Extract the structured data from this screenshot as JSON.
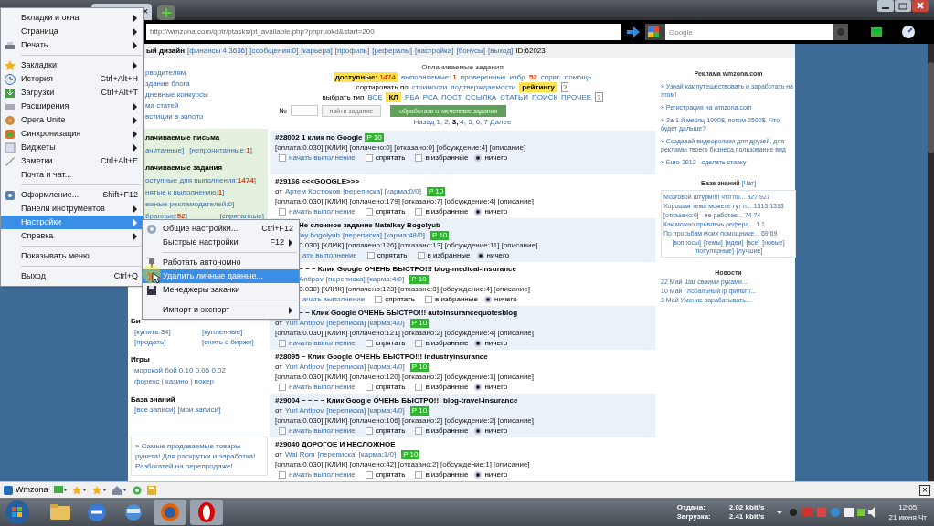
{
  "browser": {
    "tab_close": "×",
    "url": "http://wmzona.com/qptr/ptasks/pt_available.php?phpruokd&start=200",
    "search_placeholder": "Google"
  },
  "topstrip": {
    "lead": "ый дизайн",
    "links": [
      "[финансы 4.3636]",
      "[сообщения:0]",
      "[карьера]",
      "[профиль]",
      "[рефералы]",
      "[настройка]",
      "[бонусы]",
      "[выход]"
    ],
    "id": "ID:62023"
  },
  "left": {
    "top_links": [
      "рводителям",
      "здание блога",
      "дневные конкурсы",
      "ма статей",
      "встиции в золото"
    ],
    "mail_heading": "лачиваемые письма",
    "mail_links": [
      {
        "text": "ачитанные]"
      },
      {
        "text": "[непрочитанные:",
        "count": "1",
        "tail": "]"
      }
    ],
    "tasks_heading": "лачиваемые задания",
    "task_links": [
      {
        "text": "оступные для выполнения:",
        "count": "1474",
        "tail": "]"
      },
      {
        "text": "нятые к выполнению:",
        "count": "1",
        "tail": "]"
      },
      {
        "text": "ежные рекламодателей:0]"
      },
      {
        "text": "бранные:",
        "count": "52",
        "tail": "]"
      },
      {
        "text": "[спрятанные]"
      }
    ],
    "exchange_heading": "Би",
    "exchange_links": [
      "[купить:34]",
      "[купленные]",
      "[продать]",
      "[снять с биржи]"
    ],
    "games_heading": "Игры",
    "games_lines": [
      "морской бой 0.10 0.05 0.02",
      "форекс | казино | покер"
    ],
    "kb_heading": "База знаний",
    "kb_links": [
      "[все записи]",
      "[мои записи]"
    ],
    "promo": "» Самые продаваемые товары рунета! Для раскрутки и заработка! Разбогатей на перепродаже!"
  },
  "tasks_header": {
    "title": "Оплачиваемые задания",
    "filters": [
      {
        "label": "доступные:",
        "count": "1474",
        "selected": true
      },
      {
        "label": "выполняемые:",
        "count": "1",
        "selected": false
      },
      {
        "label": "проверенные",
        "selected": false
      },
      {
        "label": "избр.",
        "count": "52",
        "selected": false
      },
      {
        "label": "спрят.",
        "selected": false
      },
      {
        "label": "помощь",
        "selected": false
      }
    ],
    "sort_label": "сортировать по",
    "sorts": [
      {
        "label": "стоимости",
        "selected": false
      },
      {
        "label": "подтверждаемости",
        "selected": false
      },
      {
        "label": "рейтингу",
        "selected": true
      }
    ],
    "type_label": "выбрать тип",
    "types": [
      {
        "label": "ВСЕ",
        "selected": false
      },
      {
        "label": "КЛ",
        "selected": true
      },
      {
        "label": "РБА",
        "selected": false
      },
      {
        "label": "РСА",
        "selected": false
      },
      {
        "label": "ПОСТ",
        "selected": false
      },
      {
        "label": "ССЫЛКА",
        "selected": false
      },
      {
        "label": "СТАТЬИ",
        "selected": false
      },
      {
        "label": "ПОИСК",
        "selected": false
      },
      {
        "label": "ПРОЧЕЕ",
        "selected": false
      }
    ],
    "help": "?",
    "number_label": "№",
    "find_button": "найти задание",
    "process_button": "обработать отмеченные задания",
    "pages": [
      {
        "label": "Назад",
        "selected": false
      },
      {
        "label": "1,",
        "selected": false
      },
      {
        "label": "2,",
        "selected": false
      },
      {
        "label": "3,",
        "selected": true
      },
      {
        "label": "4,",
        "selected": false
      },
      {
        "label": "5,",
        "selected": false
      },
      {
        "label": "6,",
        "selected": false
      },
      {
        "label": "7",
        "selected": false
      },
      {
        "label": "Далее",
        "selected": false
      }
    ]
  },
  "tasks": [
    {
      "title": "#28002 1 клик по Google",
      "title_covered": false,
      "badge": "P 10",
      "info": "[оплата:0.030] [КЛИК] [оплачено:0] [отказано:0] [обсуждение:4] [описание]",
      "info_covered": false,
      "start": "начать выполнение",
      "hide": "спрятать",
      "fav": "в избранные",
      "none": "ничего",
      "none_selected": true,
      "actions_covered": false,
      "shaded": true
    },
    {
      "title": "#29166 <<<GOOGLE>>>",
      "title_covered": false,
      "from": "от",
      "author": "Артем Костюков",
      "meta": "[переписка] [карма:0/0]",
      "badge": "P 10",
      "info": "[оплата:0.030] [КЛИК] [оплачено:179] [отказано:7] [обсуждение:4] [описание]",
      "info_covered": false,
      "start": "начать выполнение",
      "hide": "спрятать",
      "fav": "в избранные",
      "none": "ничего",
      "none_selected": true,
      "actions_covered": false,
      "shaded": false
    },
    {
      "title": "Не сложное задание Natalkay Bogolyub",
      "title_covered": true,
      "author": "lay bogolyub",
      "meta": "[переписка] [карма:48/0]",
      "badge": "P 10",
      "info": "0.030] [КЛИК] [оплачено:126] [отказано:13] [обсуждение:11] [описание]",
      "info_covered": true,
      "start": "ать выполнение",
      "hide": "спрятать",
      "fav": "в избранные",
      "none": "ничего",
      "none_selected": true,
      "actions_covered": true,
      "shaded": true
    },
    {
      "title": "~ ~ ~ Клик Google ОЧЕНЬ БЫСТРО!!! blog-medical-insurance",
      "title_covered": true,
      "author": "Antipov",
      "meta": "[переписка] [карма:4/0]",
      "badge": "P 10",
      "info": "0.030] [КЛИК] [оплачено:123] [отказано:0] [обсуждение:4] [описание]",
      "info_covered": true,
      "start": "ачать выполнение",
      "hide": "спрятать",
      "fav": "в избранные",
      "none": "ничего",
      "none_selected": true,
      "actions_covered": true,
      "shaded": false
    },
    {
      "title": "~ ~ Клик Google ОЧЕНЬ БЫСТРО!!! autoinsurancequotesblog",
      "title_covered": true,
      "from": "от",
      "author": "Yuri Antipov",
      "meta": "[переписка] [карма:4/0]",
      "badge": "P 10",
      "info": "[оплата:0.030] [КЛИК] [оплачено:121] [отказано:2] [обсуждение:4] [описание]",
      "info_covered": false,
      "start": "начать выполнение",
      "hide": "спрятать",
      "fav": "в избранные",
      "none": "ничего",
      "none_selected": true,
      "actions_covered": false,
      "shaded": true
    },
    {
      "title": "#28095 ~ Клик Google ОЧЕНЬ БЫСТРО!!! industryinsurance",
      "title_covered": false,
      "from": "от",
      "author": "Yuri Antipov",
      "meta": "[переписка] [карма:4/0]",
      "badge": "P 10",
      "info": "[оплата:0.030] [КЛИК] [оплачено:120] [отказано:2] [обсуждение:1] [описание]",
      "info_covered": false,
      "start": "начать выполнение",
      "hide": "спрятать",
      "fav": "в избранные",
      "none": "ничего",
      "none_selected": true,
      "actions_covered": false,
      "shaded": false
    },
    {
      "title": "#29004 ~ ~ ~ ~ Клик Google ОЧЕНЬ БЫСТРО!!! blog-travel-insurance",
      "title_covered": false,
      "from": "от",
      "author": "Yuri Antipov",
      "meta": "[переписка] [карма:4/0]",
      "badge": "P 10",
      "info": "[оплата:0.030] [КЛИК] [оплачено:106] [отказано:2] [обсуждение:2] [описание]",
      "info_covered": false,
      "start": "начать выполнение",
      "hide": "спрятать",
      "fav": "в избранные",
      "none": "ничего",
      "none_selected": true,
      "actions_covered": false,
      "shaded": true
    },
    {
      "title": "#29040 ДОРОГОЕ И НЕСЛОЖНОЕ",
      "title_covered": false,
      "from": "от",
      "author": "Wal Rom",
      "meta": "[переписка] [карма:1/0]",
      "badge": "P 10",
      "info": "[оплата:0.030] [КЛИК] [оплачено:42] [отказано:2] [обсуждение:1] [описание]",
      "info_covered": false,
      "start": "начать выполнение",
      "hide": "спрятать",
      "fav": "в избранные",
      "none": "ничего",
      "none_selected": true,
      "actions_covered": false,
      "shaded": false
    }
  ],
  "right": {
    "ads_title": "Реклама wmzona.com",
    "ads": [
      "» Узнай как путешествовать и заработать на этом!",
      "» Регистрация на wmzona.com",
      "» За 1-й месяц-1000$, потом 2500$. Что будет дальше?",
      "» Создавай видеоролики для друзей, для рекламы твоего бизнеса.пользование вид",
      "» Euro-2012 - сделать ставку"
    ],
    "kb_title": "База знаний",
    "kb_chat": "[Чат]",
    "kb_items": [
      "Мозговой штурм!!!! что по... 927 927",
      "Хорошая тема можете тут п... 1313 1313",
      "[отказано:0] - не работае... 74 74",
      "Как можно привлечь рефера... 1 1",
      "По просьбам моих помощнике... 69 69"
    ],
    "kb_links": [
      "[вопросы]",
      "[темы]",
      "[идеи]",
      "[все]",
      "[новые]",
      "[популярные]",
      "[лучшие]"
    ],
    "news_title": "Новости",
    "news": [
      "22 Май Шаг своими руками...",
      "10 Май Глобальный ip фильтр...",
      "3 Май Умение зарабатывать..."
    ]
  },
  "menu": [
    {
      "kind": "item",
      "label": "Вкладки и окна",
      "submenu": true,
      "selected": false
    },
    {
      "kind": "item",
      "label": "Страница",
      "submenu": true,
      "selected": false
    },
    {
      "kind": "item",
      "label": "Печать",
      "submenu": true,
      "selected": false
    },
    {
      "kind": "separator"
    },
    {
      "kind": "item",
      "label": "Закладки",
      "submenu": true,
      "selected": false
    },
    {
      "kind": "item",
      "label": "История",
      "shortcut": "Ctrl+Alt+H",
      "submenu": false,
      "selected": false
    },
    {
      "kind": "item",
      "label": "Загрузки",
      "shortcut": "Ctrl+Alt+T",
      "submenu": false,
      "selected": false
    },
    {
      "kind": "item",
      "label": "Расширения",
      "submenu": true,
      "selected": false
    },
    {
      "kind": "item",
      "label": "Opera Unite",
      "submenu": true,
      "selected": false
    },
    {
      "kind": "item",
      "label": "Синхронизация",
      "submenu": true,
      "selected": false
    },
    {
      "kind": "item",
      "label": "Виджеты",
      "submenu": true,
      "selected": false
    },
    {
      "kind": "item",
      "label": "Заметки",
      "shortcut": "Ctrl+Alt+E",
      "submenu": false,
      "selected": false
    },
    {
      "kind": "item",
      "label": "Почта и чат...",
      "submenu": false,
      "selected": false
    },
    {
      "kind": "separator"
    },
    {
      "kind": "item",
      "label": "Оформление...",
      "shortcut": "Shift+F12",
      "submenu": false,
      "selected": false
    },
    {
      "kind": "item",
      "label": "Панели инструментов",
      "submenu": true,
      "selected": false
    },
    {
      "kind": "item",
      "label": "Настройки",
      "submenu": true,
      "selected": true
    },
    {
      "kind": "item",
      "label": "Справка",
      "submenu": true,
      "selected": false
    },
    {
      "kind": "separator"
    },
    {
      "kind": "item",
      "label": "Показывать меню",
      "submenu": false,
      "selected": false
    },
    {
      "kind": "separator"
    },
    {
      "kind": "item",
      "label": "Выход",
      "shortcut": "Ctrl+Q",
      "submenu": false,
      "selected": false
    }
  ],
  "submenu": [
    {
      "kind": "item",
      "label": "Общие настройки...",
      "shortcut": "Ctrl+F12",
      "submenu": false,
      "selected": false
    },
    {
      "kind": "item",
      "label": "Быстрые настройки",
      "shortcut": "F12",
      "submenu": true,
      "selected": false
    },
    {
      "kind": "separator"
    },
    {
      "kind": "item",
      "label": "Работать автономно",
      "submenu": false,
      "selected": false
    },
    {
      "kind": "item",
      "label": "Удалить личные данные...",
      "submenu": false,
      "selected": true
    },
    {
      "kind": "item",
      "label": "Менеджеры закачки",
      "submenu": false,
      "selected": false
    },
    {
      "kind": "separator"
    },
    {
      "kind": "item",
      "label": "Импорт и экспорт",
      "submenu": true,
      "selected": false
    }
  ],
  "toolbar": {
    "label": "Wmzona",
    "close": "×"
  },
  "taskbar": {
    "apps": [
      {
        "kind": "folder",
        "selected": false
      },
      {
        "kind": "safari",
        "selected": false
      },
      {
        "kind": "network",
        "selected": false
      },
      {
        "kind": "firefox",
        "selected": true
      },
      {
        "kind": "opera",
        "selected": true
      }
    ],
    "upload_label": "Отдача:",
    "upload": "2.02 kbit/s",
    "download_label": "Загрузка:",
    "download": "2.41 kbit/s",
    "time": "12:05",
    "date": "21 июня Чт"
  }
}
